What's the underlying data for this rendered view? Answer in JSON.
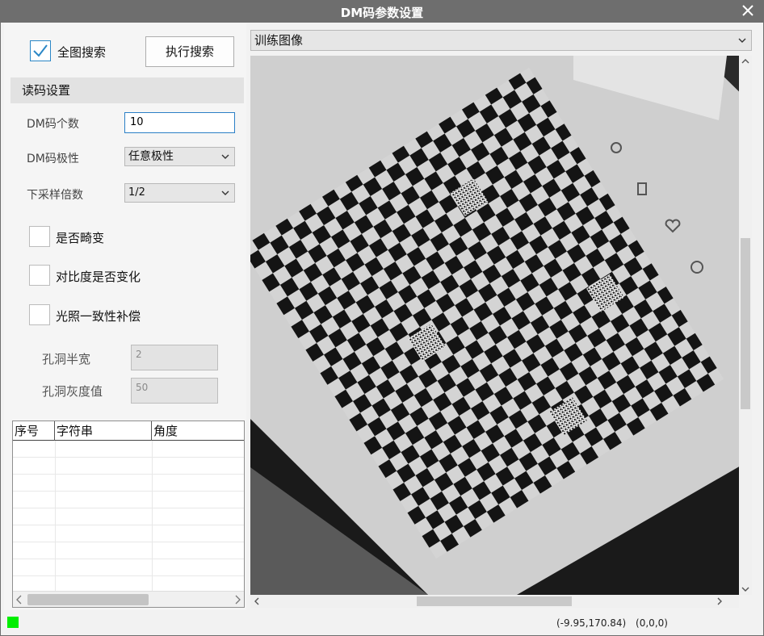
{
  "window": {
    "title": "DM码参数设置"
  },
  "search": {
    "full_image_label": "全图搜索",
    "full_image_checked": true,
    "run_button": "执行搜索"
  },
  "reader": {
    "section_title": "读码设置",
    "count_label": "DM码个数",
    "count_value": "10",
    "polarity_label": "DM码极性",
    "polarity_value": "任意极性",
    "downsample_label": "下采样倍数",
    "downsample_value": "1/2",
    "distortion_label": "是否畸变",
    "contrast_label": "对比度是否变化",
    "lighting_label": "光照一致性补偿",
    "hole_half_width_label": "孔洞半宽",
    "hole_half_width_value": "2",
    "hole_gray_label": "孔洞灰度值",
    "hole_gray_value": "50"
  },
  "results_table": {
    "columns": [
      "序号",
      "字符串",
      "角度"
    ],
    "rows": []
  },
  "image_source": {
    "selected": "训练图像"
  },
  "status": {
    "coordinates": "(-9.95,170.84)",
    "pixel_value": "(0,0,0)",
    "indicator_color": "#00ee00"
  },
  "colors": {
    "titlebar": "#6e6e6e",
    "accent": "#2b87c6"
  },
  "icons": {
    "close": "close-icon",
    "check": "check-icon",
    "dropdown": "chevron-down-icon"
  }
}
